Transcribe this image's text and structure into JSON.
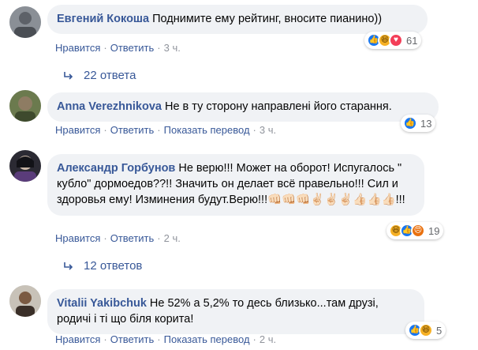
{
  "colors": {
    "link": "#385898",
    "bubble": "#f0f2f5",
    "like": "#1877f2",
    "haha": "#f7b125",
    "love": "#f33e58",
    "angry": "#e9710f"
  },
  "comments": [
    {
      "author": "Евгений Кокоша",
      "text": "Поднимите ему рейтинг, вносите пианино))",
      "reactions": [
        "like",
        "haha",
        "love"
      ],
      "reaction_count": "61",
      "actions": [
        "Нравится",
        "Ответить"
      ],
      "time": "3 ч.",
      "replies": "22 ответа"
    },
    {
      "author": "Anna Verezhnikova",
      "text": "Не в ту сторону направлені його старання.",
      "reactions": [
        "like"
      ],
      "reaction_count": "13",
      "actions": [
        "Нравится",
        "Ответить",
        "Показать перевод"
      ],
      "time": "3 ч."
    },
    {
      "author": "Александр Горбунов",
      "text": "Не верю!!! Может на оборот! Испугалось \" кубло\" дормоедов??!! Значить он делает всё правельно!!! Сил и здоровья ему! Изминения будут.Верю!!!👊🏻👊🏻👊🏻✌🏻✌🏻✌🏻👍🏻👍🏻👍🏻!!!",
      "reactions": [
        "haha",
        "like",
        "angry"
      ],
      "reaction_count": "19",
      "actions": [
        "Нравится",
        "Ответить"
      ],
      "time": "2 ч.",
      "replies": "12 ответов"
    },
    {
      "author": "Vitalii Yakibchuk",
      "text": "Не 52% а 5,2% то десь близько...там друзі, родичі і ті що біля корита!",
      "reactions": [
        "like",
        "haha"
      ],
      "reaction_count": "5",
      "actions": [
        "Нравится",
        "Ответить",
        "Показать перевод"
      ],
      "time": "2 ч."
    }
  ]
}
